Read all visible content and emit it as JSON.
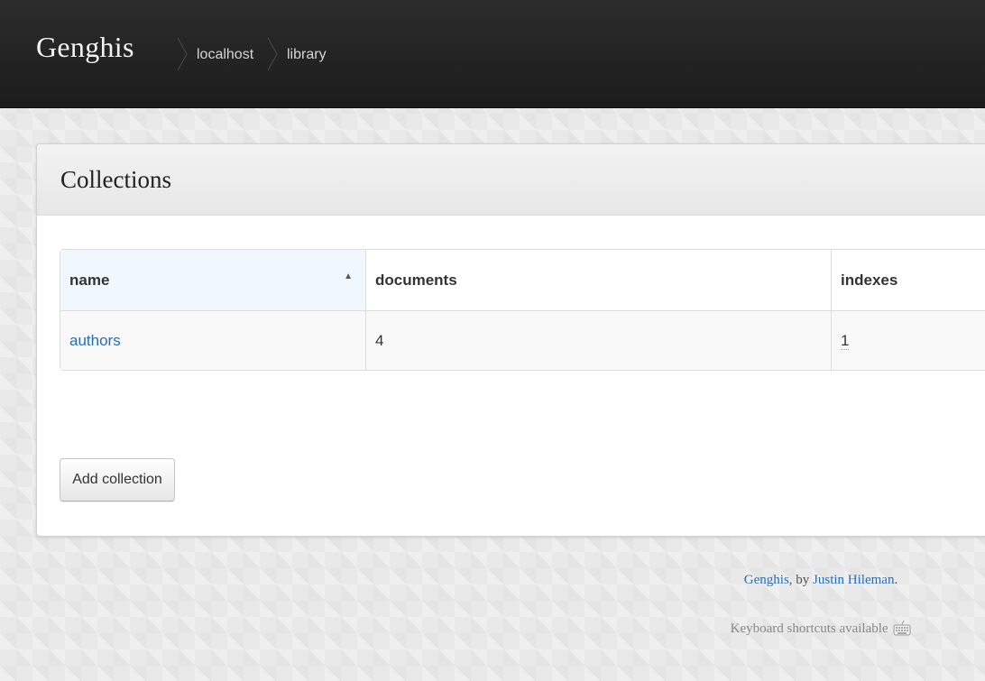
{
  "navbar": {
    "brand": "Genghis",
    "breadcrumbs": [
      "localhost",
      "library"
    ]
  },
  "panel": {
    "title": "Collections",
    "table": {
      "columns": [
        "name",
        "documents",
        "indexes"
      ],
      "sorted_column": "name",
      "sort_direction": "ascending",
      "rows": [
        {
          "name": "authors",
          "documents": "4",
          "indexes": "1"
        }
      ]
    },
    "add_button_label": "Add collection"
  },
  "footer": {
    "app_link": "Genghis",
    "by_text": ", by ",
    "author_link": "Justin Hileman",
    "period": ".",
    "shortcuts_text": "Keyboard shortcuts available",
    "shortcuts_icon": "keyboard-icon"
  },
  "colors": {
    "navbar": "#1f1f1f",
    "link": "#2a6db5",
    "background": "#e9e9e9"
  }
}
